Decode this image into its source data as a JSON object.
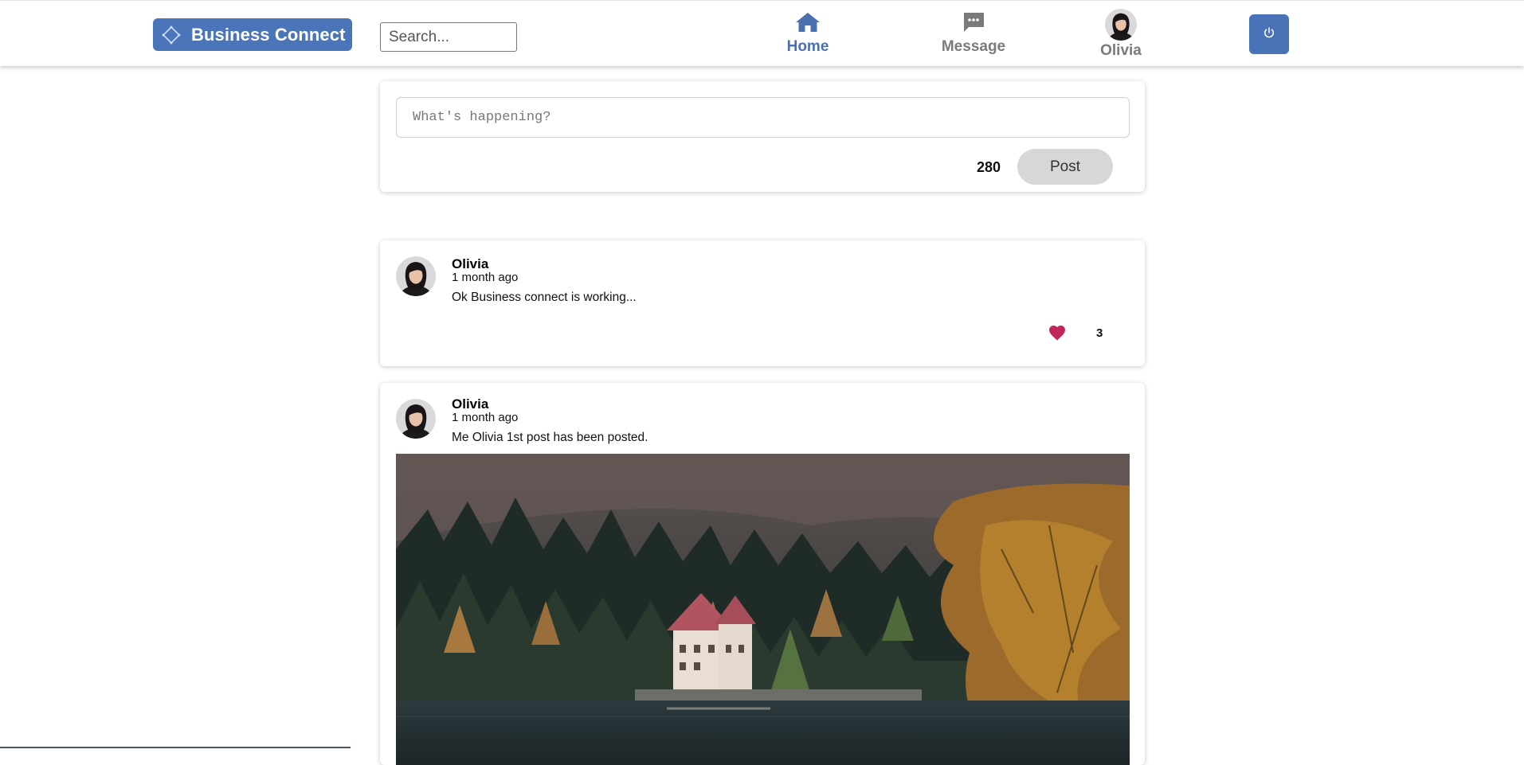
{
  "brand": {
    "name": "Business Connect",
    "color": "#4a75b8",
    "icon": "diamond-icon"
  },
  "search": {
    "placeholder": "Search..."
  },
  "nav": {
    "home": {
      "label": "Home",
      "icon": "home-icon",
      "active": true
    },
    "message": {
      "label": "Message",
      "icon": "message-icon"
    },
    "profile": {
      "label": "Olivia",
      "icon": "avatar"
    }
  },
  "logout": {
    "icon": "power-icon",
    "color": "#4a72b7"
  },
  "composer": {
    "placeholder": "What's happening?",
    "char_count": "280",
    "post_label": "Post"
  },
  "posts": [
    {
      "author": "Olivia",
      "time": "1 month ago",
      "text": "Ok Business connect is working...",
      "likes": "3",
      "liked": true
    },
    {
      "author": "Olivia",
      "time": "1 month ago",
      "text": "Me Olivia 1st post has been posted.",
      "has_image": true
    }
  ],
  "colors": {
    "like": "#c2255c",
    "accent": "#4a70b0",
    "inactive_nav": "#7a7a7a"
  }
}
